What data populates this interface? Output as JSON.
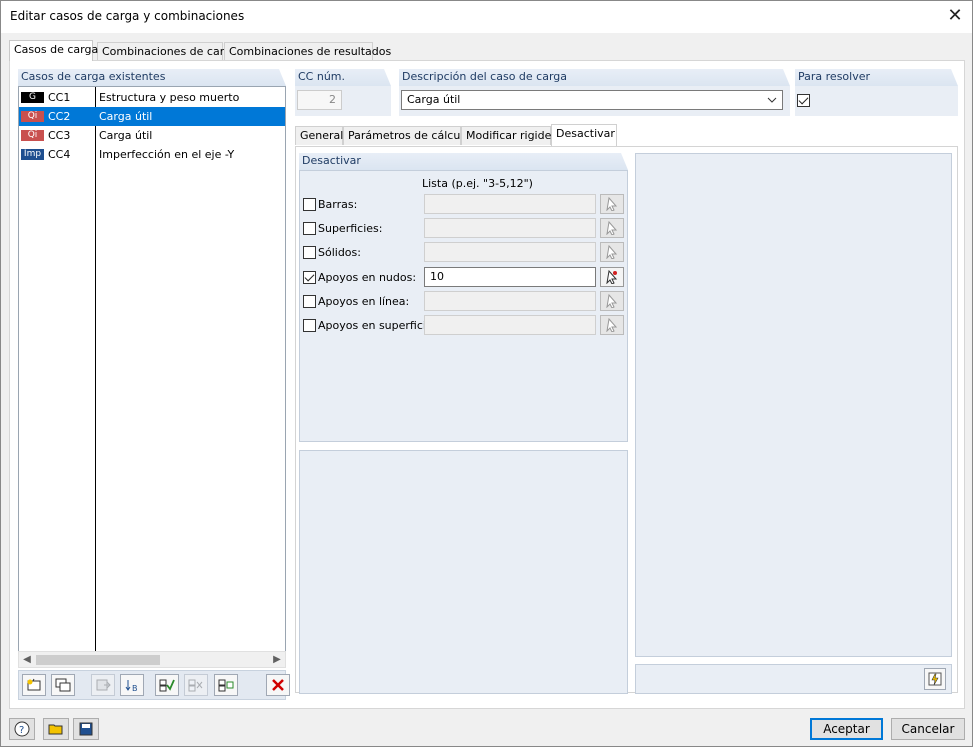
{
  "window": {
    "title": "Editar casos de carga y combinaciones"
  },
  "top_tabs": [
    "Casos de carga",
    "Combinaciones de carga",
    "Combinaciones de resultados"
  ],
  "left_panel": {
    "header": "Casos de carga existentes",
    "items": [
      {
        "badge": "G",
        "badge_color": "#000000",
        "code": "CC1",
        "desc": "Estructura y peso muerto",
        "selected": false
      },
      {
        "badge": "Qi",
        "badge_color": "#c9504f",
        "code": "CC2",
        "desc": "Carga útil",
        "selected": true
      },
      {
        "badge": "Qi",
        "badge_color": "#c9504f",
        "code": "CC3",
        "desc": "Carga útil",
        "selected": false
      },
      {
        "badge": "Imp",
        "badge_color": "#1f4f8f",
        "code": "CC4",
        "desc": "Imperfección en el eje -Y",
        "selected": false
      }
    ]
  },
  "cc_num": {
    "label": "CC núm.",
    "value": "2"
  },
  "description": {
    "label": "Descripción del caso de carga",
    "value": "Carga útil"
  },
  "para_resolver": {
    "label": "Para resolver",
    "checked": true
  },
  "sub_tabs": [
    "General",
    "Parámetros de cálculo",
    "Modificar rigidez",
    "Desactivar"
  ],
  "deactivate": {
    "header": "Desactivar",
    "list_hint": "Lista (p.ej. \"3-5,12\")",
    "rows": [
      {
        "label": "Barras:",
        "checked": false,
        "value": ""
      },
      {
        "label": "Superficies:",
        "checked": false,
        "value": ""
      },
      {
        "label": "Sólidos:",
        "checked": false,
        "value": ""
      },
      {
        "label": "Apoyos en nudos:",
        "checked": true,
        "value": "10"
      },
      {
        "label": "Apoyos en línea:",
        "checked": false,
        "value": ""
      },
      {
        "label": "Apoyos en superficie",
        "checked": false,
        "value": ""
      }
    ]
  },
  "buttons": {
    "ok": "Aceptar",
    "cancel": "Cancelar"
  }
}
